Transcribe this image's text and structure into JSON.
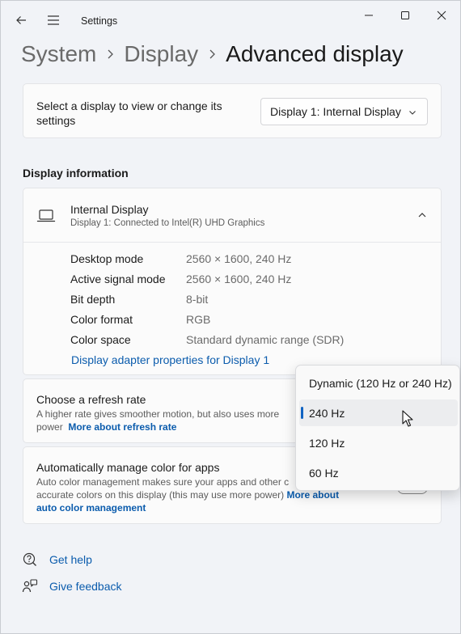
{
  "window": {
    "title": "Settings"
  },
  "breadcrumb": {
    "items": [
      "System",
      "Display",
      "Advanced display"
    ]
  },
  "display_select": {
    "label": "Select a display to view or change its settings",
    "selected": "Display 1: Internal Display"
  },
  "display_info": {
    "heading": "Display information",
    "name": "Internal Display",
    "subtitle": "Display 1: Connected to Intel(R) UHD Graphics",
    "rows": [
      {
        "key": "Desktop mode",
        "value": "2560 × 1600, 240 Hz"
      },
      {
        "key": "Active signal mode",
        "value": "2560 × 1600, 240 Hz"
      },
      {
        "key": "Bit depth",
        "value": "8-bit"
      },
      {
        "key": "Color format",
        "value": "RGB"
      },
      {
        "key": "Color space",
        "value": "Standard dynamic range (SDR)"
      }
    ],
    "adapter_link": "Display adapter properties for Display 1"
  },
  "refresh_rate": {
    "title": "Choose a refresh rate",
    "desc_line1": "A higher rate gives smoother motion, but also uses more",
    "desc_line2": "power",
    "link": "More about refresh rate",
    "options": [
      "Dynamic (120 Hz or 240 Hz)",
      "240 Hz",
      "120 Hz",
      "60 Hz"
    ],
    "selected": "240 Hz"
  },
  "color_mgmt": {
    "title": "Automatically manage color for apps",
    "desc_line1": "Auto color management makes sure your apps and other c",
    "desc_line2": "accurate colors on this display (this may use more power)",
    "link_part1": "More about",
    "link_part2": "auto color management"
  },
  "footer": {
    "help": "Get help",
    "feedback": "Give feedback"
  },
  "colors": {
    "accent": "#0b5cad",
    "selection_indicator": "#1063c2"
  }
}
